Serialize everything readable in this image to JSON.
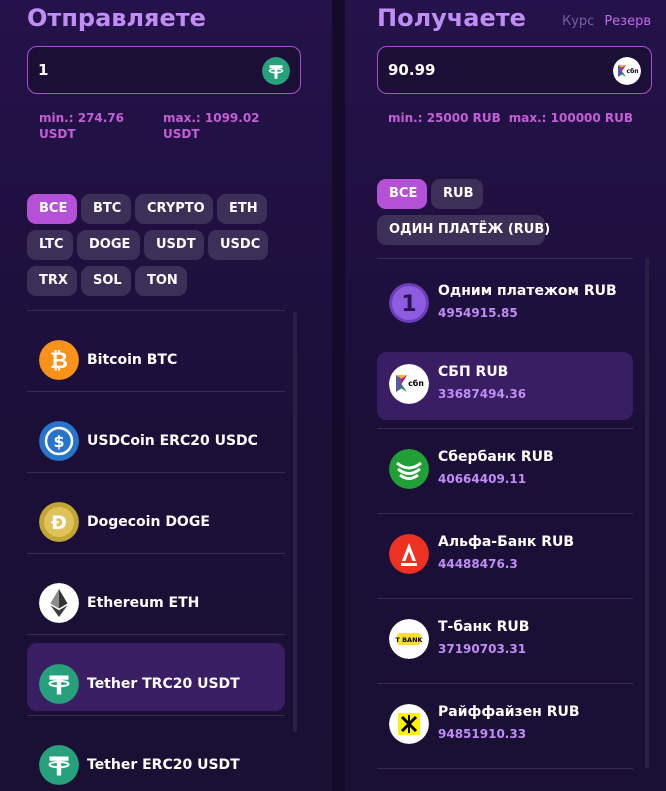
{
  "send": {
    "title": "Отправляете",
    "amount": "1",
    "coin_icon": "tether-icon",
    "min": "min.: 274.76 USDT",
    "max": "max.: 1099.02 USDT",
    "filters": [
      "ВСЕ",
      "BTC",
      "CRYPTO",
      "ETH",
      "LTC",
      "DOGE",
      "USDT",
      "USDC",
      "TRX",
      "SOL",
      "TON"
    ],
    "active_filter": "ВСЕ",
    "items": [
      {
        "name": "Bitcoin BTC",
        "icon": "bitcoin-icon"
      },
      {
        "name": "USDCoin ERC20 USDC",
        "icon": "usdc-icon"
      },
      {
        "name": "Dogecoin DOGE",
        "icon": "dogecoin-icon"
      },
      {
        "name": "Ethereum ETH",
        "icon": "ethereum-icon"
      },
      {
        "name": "Tether TRC20 USDT",
        "icon": "tether-icon",
        "selected": true
      },
      {
        "name": "Tether ERC20 USDT",
        "icon": "tether-icon"
      }
    ]
  },
  "receive": {
    "title": "Получаете",
    "rate_label": "Курс",
    "reserve_label": "Резерв",
    "amount": "90.99",
    "coin_icon": "sbp-icon",
    "min": "min.: 25000 RUB",
    "max": "max.: 100000 RUB",
    "filters": [
      "ВСЕ",
      "RUB",
      "ОДИН ПЛАТЁЖ (RUB)"
    ],
    "active_filter": "ВСЕ",
    "items": [
      {
        "name": "Одним платежом RUB",
        "reserve": "4954915.85",
        "icon": "one-payment-icon"
      },
      {
        "name": "СБП RUB",
        "reserve": "33687494.36",
        "icon": "sbp-icon",
        "selected": true
      },
      {
        "name": "Сбербанк RUB",
        "reserve": "40664409.11",
        "icon": "sberbank-icon"
      },
      {
        "name": "Альфа-Банк RUB",
        "reserve": "44488476.3",
        "icon": "alfabank-icon"
      },
      {
        "name": "Т-банк RUB",
        "reserve": "37190703.31",
        "icon": "tbank-icon"
      },
      {
        "name": "Райффайзен RUB",
        "reserve": "94851910.33",
        "icon": "raiffeisen-icon"
      }
    ]
  },
  "colors": {
    "accent": "#b551d6",
    "title": "#c08cf5",
    "limit_text": "#c45fd6",
    "chip": "#3c2f58",
    "selected_row": "#3a1e63",
    "tether": "#26a17b",
    "bitcoin": "#f7931a",
    "usdc": "#2775ca",
    "dogecoin": "#c2a633",
    "sberbank": "#21a038",
    "alfabank": "#ef3124",
    "tbank": "#ffdd2d",
    "raiffeisen": "#fff200"
  }
}
